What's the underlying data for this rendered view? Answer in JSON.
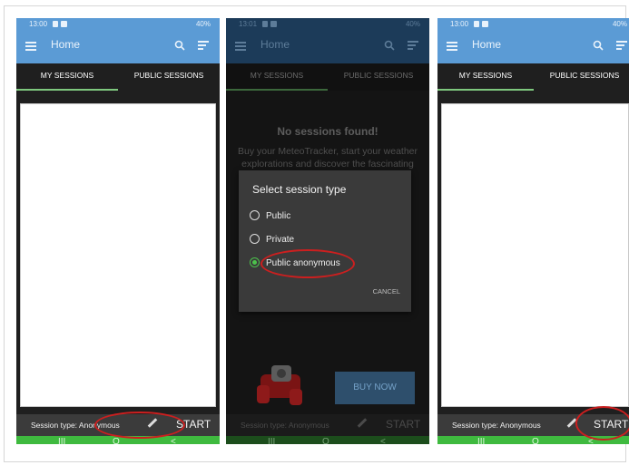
{
  "phones": [
    {
      "status_time": "13:00",
      "status_right": "40%",
      "app_title": "Home",
      "tabs": [
        "MY SESSIONS",
        "PUBLIC SESSIONS"
      ],
      "session_type": "Session type: Anonymous",
      "start_label": "START",
      "nav": [
        "III",
        "O",
        "<"
      ]
    },
    {
      "status_time": "13:01",
      "status_right": "40%",
      "app_title": "Home",
      "tabs": [
        "MY SESSIONS",
        "PUBLIC SESSIONS"
      ],
      "no_sessions_title": "No sessions found!",
      "no_sessions_text": "Buy your MeteoTracker, start your weather explorations and discover the fascinating dimension of",
      "dialog": {
        "title": "Select session type",
        "options": [
          "Public",
          "Private",
          "Public anonymous"
        ],
        "selected": "Public anonymous",
        "cancel_label": "CANCEL"
      },
      "buy_now_label": "BUY NOW",
      "session_type": "Session type: Anonymous",
      "start_label": "START",
      "nav": [
        "III",
        "O",
        "<"
      ]
    },
    {
      "status_time": "13:00",
      "status_right": "40%",
      "app_title": "Home",
      "tabs": [
        "MY SESSIONS",
        "PUBLIC SESSIONS"
      ],
      "session_type": "Session type: Anonymous",
      "start_label": "START",
      "nav": [
        "III",
        "O",
        "<"
      ]
    }
  ],
  "colors": {
    "app_bar": "#5b9bd5",
    "tab_bar": "#1f1f1f",
    "tab_indicator": "#7ec87e",
    "nav_bar": "#3fba3f",
    "annotation": "#cc1f1f",
    "radio_selected": "#4cc24c"
  },
  "icons": [
    "menu-icon",
    "search-icon",
    "filter-icon",
    "pencil-icon",
    "recent-apps-icon",
    "home-icon",
    "back-icon"
  ]
}
